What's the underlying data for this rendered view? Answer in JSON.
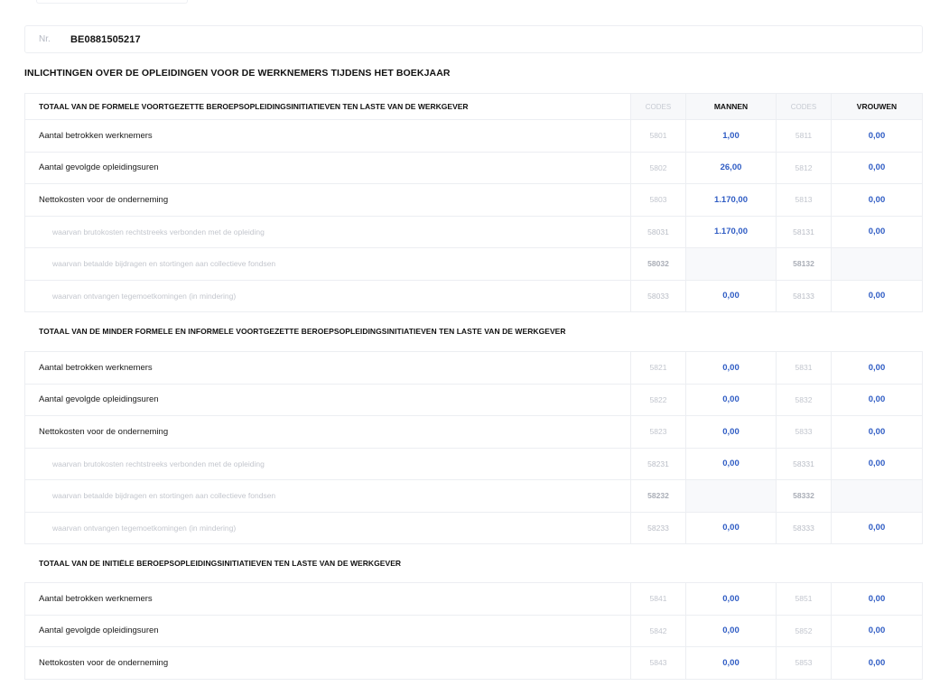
{
  "identification": {
    "nr_label": "Nr.",
    "nr_value": "BE0881505217"
  },
  "main_title": "INLICHTINGEN OVER DE OPLEIDINGEN VOOR DE WERKNEMERS TIJDENS HET BOEKJAAR",
  "columns": {
    "codes": "CODES",
    "mannen": "MANNEN",
    "vrouwen": "VROUWEN"
  },
  "section1": {
    "heading": "TOTAAL VAN DE FORMELE VOORTGEZETTE BEROEPSOPLEIDINGSINITIATIEVEN TEN LASTE VAN DE WERKGEVER",
    "rows": [
      {
        "label": "Aantal betrokken werknemers",
        "code_m": "5801",
        "mannen": "1,00",
        "code_v": "5811",
        "vrouwen": "0,00"
      },
      {
        "label": "Aantal gevolgde opleidingsuren",
        "code_m": "5802",
        "mannen": "26,00",
        "code_v": "5812",
        "vrouwen": "0,00"
      },
      {
        "label": "Nettokosten voor de onderneming",
        "code_m": "5803",
        "mannen": "1.170,00",
        "code_v": "5813",
        "vrouwen": "0,00"
      },
      {
        "label": "waarvan brutokosten rechtstreeks verbonden met de opleiding",
        "code_m": "58031",
        "mannen": "1.170,00",
        "code_v": "58131",
        "vrouwen": "0,00"
      },
      {
        "label": "waarvan betaalde bijdragen en stortingen aan collectieve fondsen",
        "code_m": "58032",
        "mannen": "",
        "code_v": "58132",
        "vrouwen": ""
      },
      {
        "label": "waarvan ontvangen tegemoetkomingen (in mindering)",
        "code_m": "58033",
        "mannen": "0,00",
        "code_v": "58133",
        "vrouwen": "0,00"
      }
    ]
  },
  "section2": {
    "heading": "TOTAAL VAN DE MINDER FORMELE EN INFORMELE VOORTGEZETTE BEROEPSOPLEIDINGSINITIATIEVEN TEN LASTE VAN DE WERKGEVER",
    "rows": [
      {
        "label": "Aantal betrokken werknemers",
        "code_m": "5821",
        "mannen": "0,00",
        "code_v": "5831",
        "vrouwen": "0,00"
      },
      {
        "label": "Aantal gevolgde opleidingsuren",
        "code_m": "5822",
        "mannen": "0,00",
        "code_v": "5832",
        "vrouwen": "0,00"
      },
      {
        "label": "Nettokosten voor de onderneming",
        "code_m": "5823",
        "mannen": "0,00",
        "code_v": "5833",
        "vrouwen": "0,00"
      },
      {
        "label": "waarvan brutokosten rechtstreeks verbonden met de opleiding",
        "code_m": "58231",
        "mannen": "0,00",
        "code_v": "58331",
        "vrouwen": "0,00"
      },
      {
        "label": "waarvan betaalde bijdragen en stortingen aan collectieve fondsen",
        "code_m": "58232",
        "mannen": "",
        "code_v": "58332",
        "vrouwen": ""
      },
      {
        "label": "waarvan ontvangen tegemoetkomingen (in mindering)",
        "code_m": "58233",
        "mannen": "0,00",
        "code_v": "58333",
        "vrouwen": "0,00"
      }
    ]
  },
  "section3": {
    "heading": "TOTAAL VAN DE INITIËLE BEROEPSOPLEIDINGSINITIATIEVEN TEN LASTE VAN DE WERKGEVER",
    "rows": [
      {
        "label": "Aantal betrokken werknemers",
        "code_m": "5841",
        "mannen": "0,00",
        "code_v": "5851",
        "vrouwen": "0,00"
      },
      {
        "label": "Aantal gevolgde opleidingsuren",
        "code_m": "5842",
        "mannen": "0,00",
        "code_v": "5852",
        "vrouwen": "0,00"
      },
      {
        "label": "Nettokosten voor de onderneming",
        "code_m": "5843",
        "mannen": "0,00",
        "code_v": "5853",
        "vrouwen": "0,00"
      }
    ]
  },
  "colors": {
    "value_blue": "#2f5cc4",
    "border": "#eceef2",
    "muted": "#c2c6ce"
  }
}
